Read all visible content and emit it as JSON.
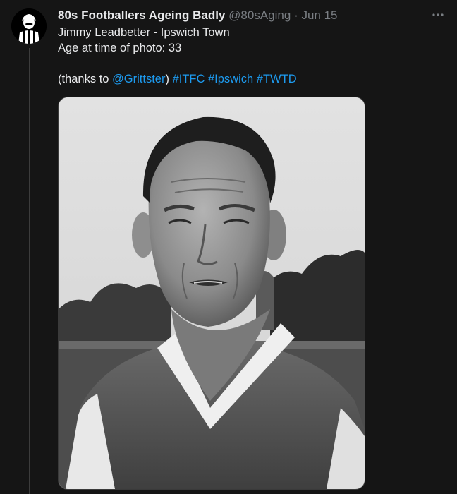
{
  "author": {
    "display_name": "80s Footballers Ageing Badly",
    "handle": "@80sAging",
    "separator": "·",
    "date": "Jun 15"
  },
  "tweet": {
    "line1": "Jimmy Leadbetter - Ipswich Town",
    "line2": "Age at time of photo: 33",
    "thanks_prefix": "(thanks to ",
    "mention": "@Grittster",
    "thanks_suffix": ") ",
    "hashtags": [
      "#ITFC",
      "#Ipswich",
      "#TWTD"
    ]
  },
  "icons": {
    "more": "more-horizontal-icon",
    "avatar": "footballer-avatar-icon"
  },
  "colors": {
    "background": "#151515",
    "text": "#e9eaec",
    "secondary_text": "#7a7e83",
    "link": "#1d9bf0"
  }
}
